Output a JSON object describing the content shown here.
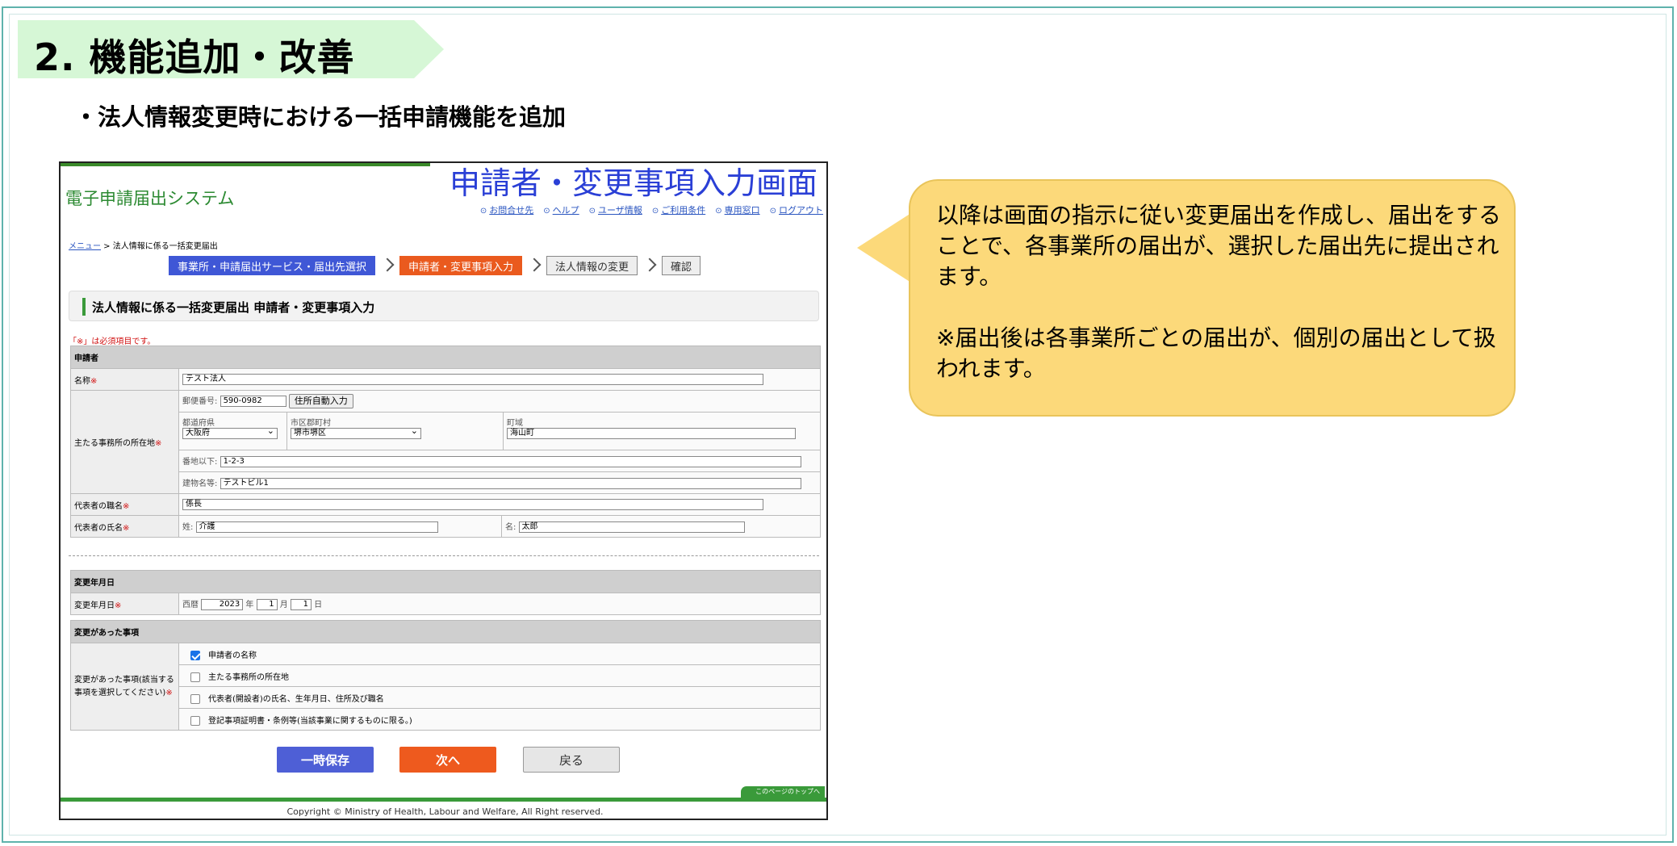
{
  "section_title": "2. 機能追加・改善",
  "subtitle": "・法人情報変更時における一括申請機能を追加",
  "screen_label": "申請者・変更事項入力画面",
  "app": {
    "title": "電子申請届出システム",
    "toplinks": [
      "お問合せ先",
      "ヘルプ",
      "ユーザ情報",
      "ご利用条件",
      "専用窓口",
      "ログアウト"
    ],
    "breadcrumb_link": "メニュー",
    "breadcrumb_rest": " > 法人情報に係る一括変更届出"
  },
  "steps": [
    "事業所・申請届出サービス・届出先選択",
    "申請者・変更事項入力",
    "法人情報の変更",
    "確認"
  ],
  "heading": "法人情報に係る一括変更届出 申請者・変更事項入力",
  "required_note": "「※」は必須項目です。",
  "applicant": {
    "section": "申請者",
    "name_label": "名称",
    "name_value": "テスト法人",
    "address_label": "主たる事務所の所在地",
    "postal_label": "郵便番号:",
    "postal_value": "590-0982",
    "auto_address_button": "住所自動入力",
    "pref_label": "都道府県",
    "pref_value": "大阪府",
    "city_label": "市区郡町村",
    "city_value": "堺市堺区",
    "town_label": "町域",
    "town_value": "海山町",
    "banchi_label": "番地以下:",
    "banchi_value": "1-2-3",
    "building_label": "建物名等:",
    "building_value": "テストビル1",
    "rep_title_label": "代表者の職名",
    "rep_title_value": "係長",
    "rep_name_label": "代表者の氏名",
    "last_label": "姓:",
    "last_value": "介護",
    "first_label": "名:",
    "first_value": "太郎",
    "required_mark": "※"
  },
  "change_date": {
    "section": "変更年月日",
    "label": "変更年月日",
    "era": "西暦",
    "year": "2023",
    "year_unit": "年",
    "month": "1",
    "month_unit": "月",
    "day": "1",
    "day_unit": "日"
  },
  "change_items": {
    "section": "変更があった事項",
    "label": "変更があった事項(該当する事項を選択してください)",
    "options": [
      {
        "label": "申請者の名称",
        "checked": true
      },
      {
        "label": "主たる事務所の所在地",
        "checked": false
      },
      {
        "label": "代表者(開設者)の氏名、生年月日、住所及び職名",
        "checked": false
      },
      {
        "label": "登記事項証明書・条例等(当該事業に関するものに限る。)",
        "checked": false
      }
    ]
  },
  "buttons": {
    "save": "一時保存",
    "next": "次へ",
    "back": "戻る"
  },
  "page_top": "このページのトップへ",
  "copyright": "Copyright © Ministry of Health, Labour and Welfare, All Right reserved.",
  "callout": {
    "line1": "以降は画面の指示に従い変更届出を作成し、届出をすることで、各事業所の届出が、選択した届出先に提出されます。",
    "line2": "※届出後は各事業所ごとの届出が、個別の届出として扱われます。"
  },
  "colors": {
    "accent_green": "#3a9a3a",
    "step_blue": "#3f57d6",
    "step_orange": "#ea5a1e",
    "callout": "#fcd97a",
    "title_band": "#d6f7d6"
  }
}
